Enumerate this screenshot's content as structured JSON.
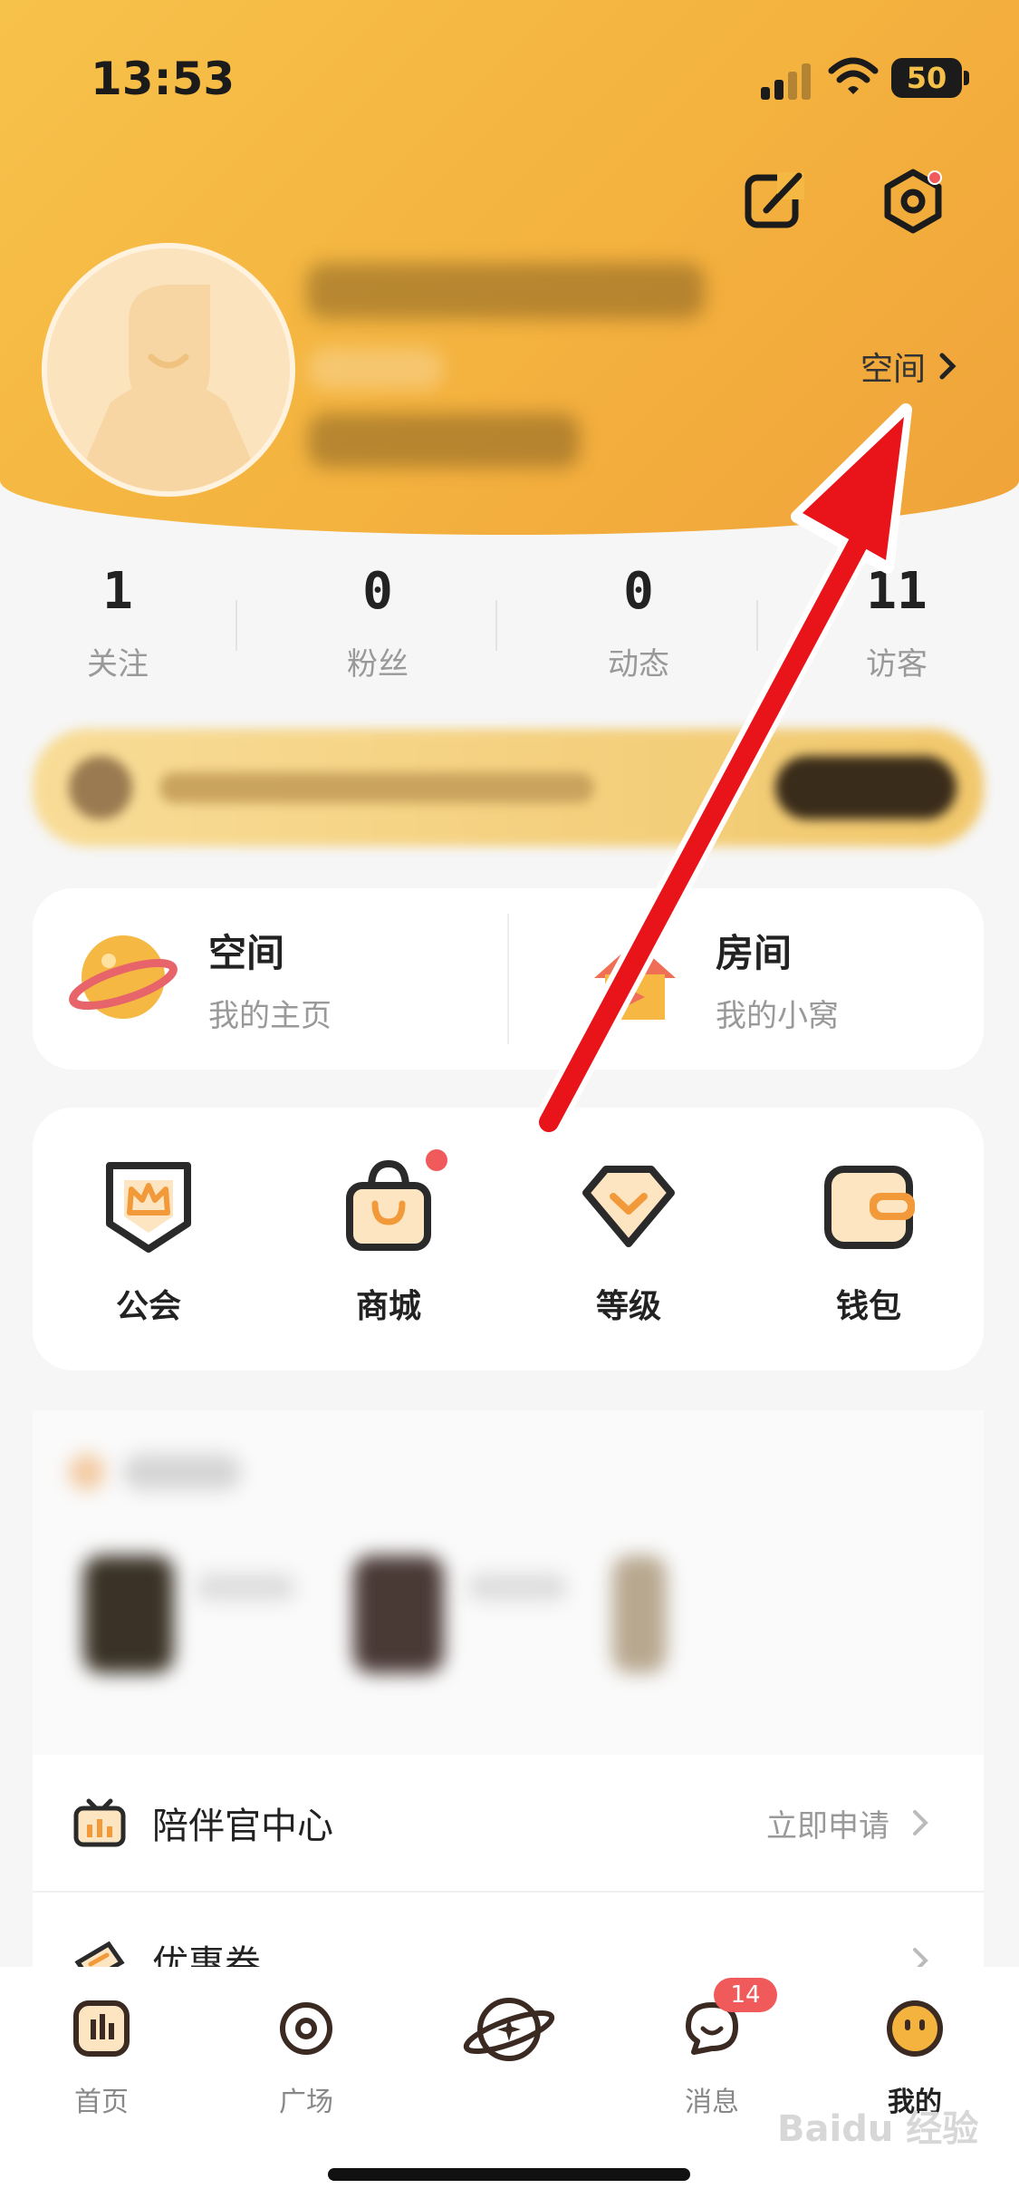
{
  "status_bar": {
    "time": "13:53",
    "battery": "50"
  },
  "profile": {
    "space_link_label": "空间"
  },
  "stats": [
    {
      "value": "1",
      "label": "关注"
    },
    {
      "value": "0",
      "label": "粉丝"
    },
    {
      "value": "0",
      "label": "动态"
    },
    {
      "value": "11",
      "label": "访客"
    }
  ],
  "entries": [
    {
      "title": "空间",
      "subtitle": "我的主页"
    },
    {
      "title": "房间",
      "subtitle": "我的小窝"
    }
  ],
  "functions": [
    {
      "label": "公会",
      "icon": "guild-crown-icon"
    },
    {
      "label": "商城",
      "icon": "shopping-bag-icon",
      "has_red_dot": true
    },
    {
      "label": "等级",
      "icon": "level-diamond-icon"
    },
    {
      "label": "钱包",
      "icon": "wallet-icon"
    }
  ],
  "list_items": [
    {
      "label": "陪伴官中心",
      "right_text": "立即申请",
      "icon": "tv-icon"
    },
    {
      "label": "优惠券",
      "right_text": "",
      "icon": "coupon-icon"
    }
  ],
  "tabbar": [
    {
      "label": "首页",
      "icon": "home-bars-icon",
      "active": false
    },
    {
      "label": "广场",
      "icon": "plaza-circle-icon",
      "active": false
    },
    {
      "label": "",
      "icon": "planet-center-icon",
      "active": false
    },
    {
      "label": "消息",
      "icon": "message-bubble-icon",
      "active": false,
      "badge": "14"
    },
    {
      "label": "我的",
      "icon": "face-icon",
      "active": true
    }
  ],
  "watermark": "Baidu 经验",
  "colors": {
    "accent": "#f4b23e",
    "badge": "#f05a5a",
    "arrow": "#e8141a"
  }
}
